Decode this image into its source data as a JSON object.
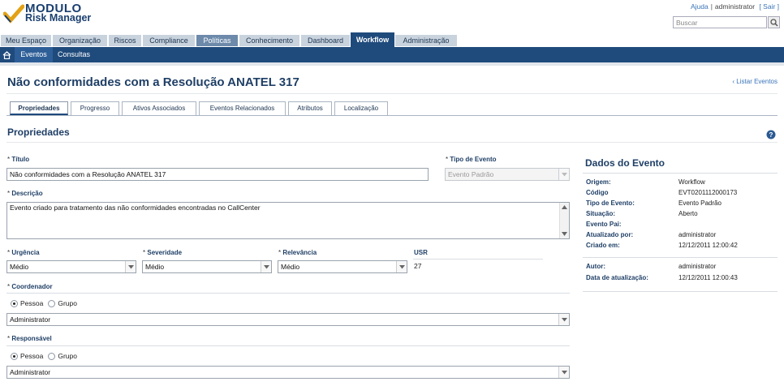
{
  "brand": {
    "line1": "MODULO",
    "line2": "Risk Manager"
  },
  "top_links": {
    "help": "Ajuda",
    "user": "administrator",
    "logout": "[ Sair ]"
  },
  "search": {
    "placeholder": "Buscar"
  },
  "main_tabs": [
    {
      "label": "Meu Espaço"
    },
    {
      "label": "Organização"
    },
    {
      "label": "Riscos"
    },
    {
      "label": "Compliance"
    },
    {
      "label": "Políticas"
    },
    {
      "label": "Conhecimento"
    },
    {
      "label": "Dashboard"
    },
    {
      "label": "Workflow"
    },
    {
      "label": "Administração"
    }
  ],
  "sub_nav": [
    {
      "label": "Eventos"
    },
    {
      "label": "Consultas"
    }
  ],
  "page": {
    "title": "Não conformidades com a Resolução ANATEL 317",
    "list_link": "Listar Eventos"
  },
  "tabs": [
    {
      "label": "Propriedades"
    },
    {
      "label": "Progresso"
    },
    {
      "label": "Ativos Associados"
    },
    {
      "label": "Eventos Relacionados"
    },
    {
      "label": "Atributos"
    },
    {
      "label": "Localização"
    }
  ],
  "section": {
    "title": "Propriedades"
  },
  "form": {
    "req_mark": "*",
    "titulo": {
      "label": "Título",
      "value": "Não conformidades com a Resolução ANATEL 317"
    },
    "tipo": {
      "label": "Tipo de Evento",
      "value": "Evento Padrão"
    },
    "descricao": {
      "label": "Descrição",
      "value": "Evento criado para tratamento das não conformidades encontradas no CallCenter"
    },
    "urgencia": {
      "label": "Urgência",
      "value": "Médio"
    },
    "severidade": {
      "label": "Severidade",
      "value": "Médio"
    },
    "relevancia": {
      "label": "Relevância",
      "value": "Médio"
    },
    "usr": {
      "label": "USR",
      "value": "27"
    },
    "coordenador": {
      "label": "Coordenador",
      "opt_pessoa": "Pessoa",
      "opt_grupo": "Grupo",
      "value": "Administrator"
    },
    "responsavel": {
      "label": "Responsável",
      "opt_pessoa": "Pessoa",
      "opt_grupo": "Grupo",
      "value": "Administrator"
    }
  },
  "dados": {
    "title": "Dados do Evento",
    "rows": [
      {
        "k": "Origem:",
        "v": "Workflow"
      },
      {
        "k": "Código",
        "v": "EVT0201112000173"
      },
      {
        "k": "Tipo de Evento:",
        "v": "Evento Padrão"
      },
      {
        "k": "Situação:",
        "v": "Aberto"
      },
      {
        "k": "Evento Pai:",
        "v": ""
      },
      {
        "k": "Atualizado por:",
        "v": "administrator"
      },
      {
        "k": "Criado em:",
        "v": "12/12/2011 12:00:42"
      },
      {
        "k": "Autor:",
        "v": "administrator"
      },
      {
        "k": "Data de atualização:",
        "v": "12/12/2011 12:00:43"
      }
    ]
  },
  "colors": {
    "navy": "#1f4a7c",
    "tab_bg": "#c9d3de",
    "label": "#1f3f66",
    "link": "#3a74b8"
  }
}
